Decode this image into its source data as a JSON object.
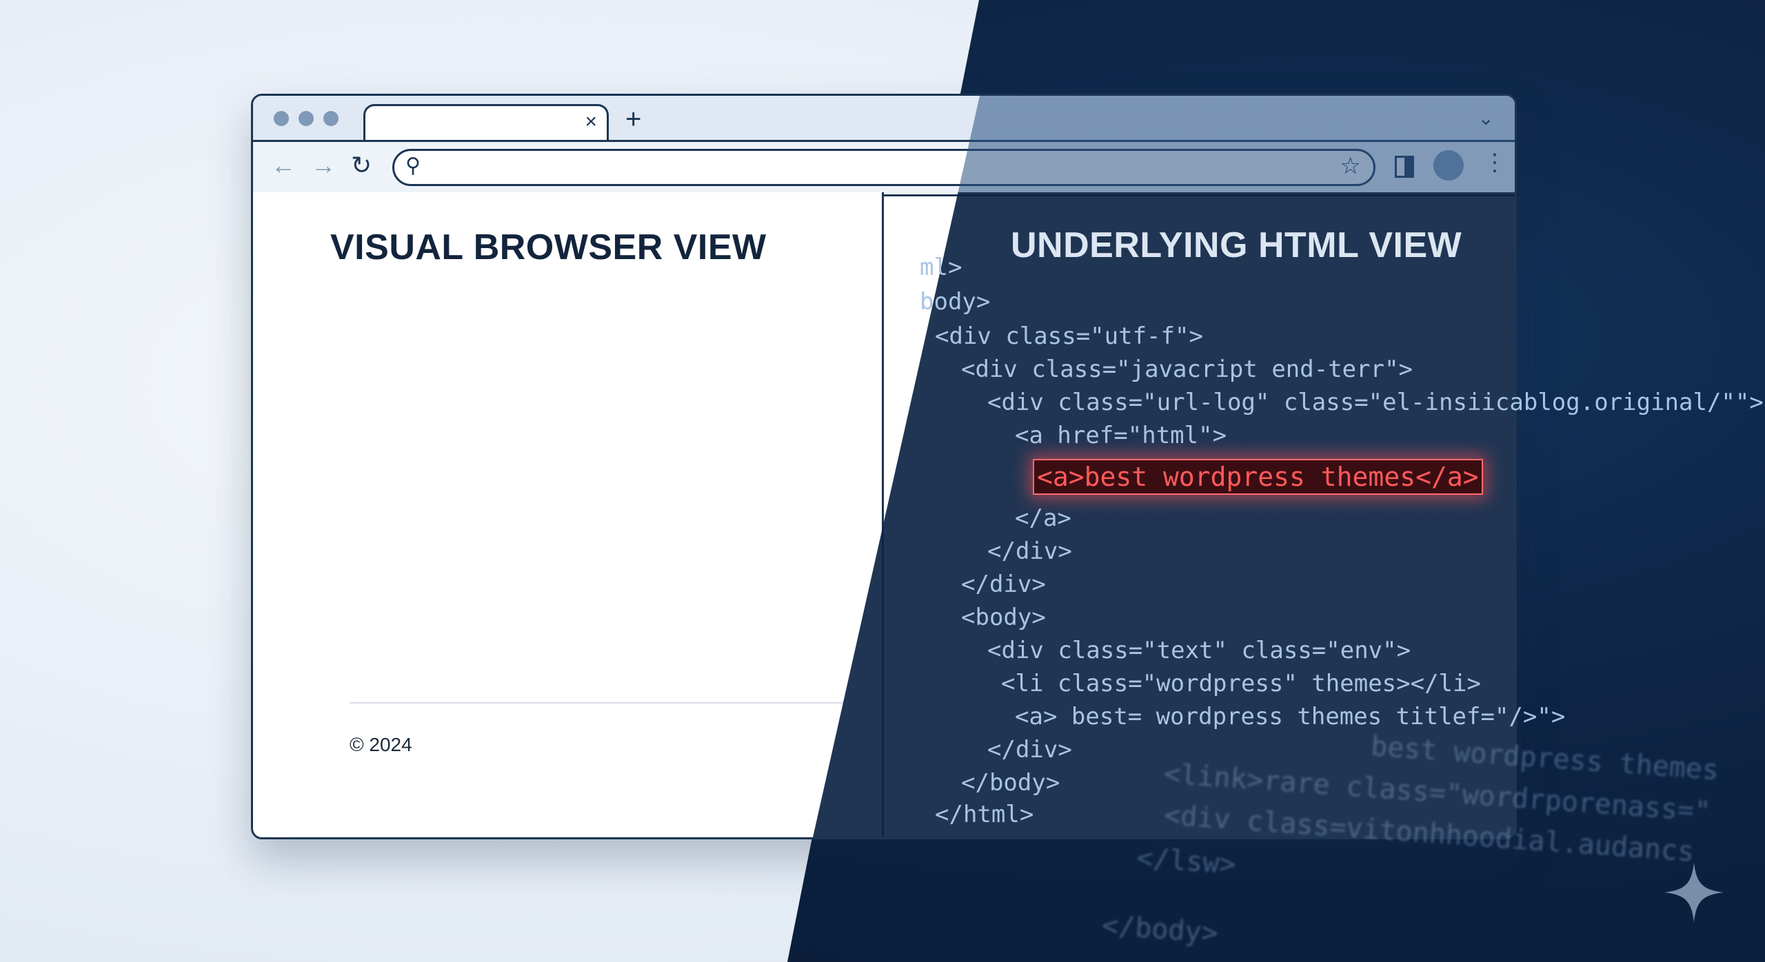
{
  "left_panel": {
    "title": "VISUAL BROWSER VIEW",
    "copyright": "© 2024"
  },
  "right_panel": {
    "title": "UNDERLYING HTML VIEW",
    "code_lines": [
      "ml>",
      "body>",
      "<div class=\"utf-f\">",
      "<div class=\"javacript end-terr\">",
      "<div class=\"url-log\" class=\"el-insiicablog.original/\"\">",
      "<a href=\"html\">",
      "</a>",
      "</div>",
      "</div>",
      "<body>",
      "<div class=\"text\" class=\"env\">",
      "<li class=\"wordpress\" themes></li>",
      "<a> best= wordpress themes titlef=\"/>\">",
      "</div>",
      "</body>",
      "</html>"
    ],
    "highlighted": "<a>best wordpress themes</a>",
    "ghost_lines": [
      "best wordpress themes",
      "<link>rare class=\"wordrporenass=\"",
      "<div class=vitonhhoodial.audancs",
      "</lsw>",
      "</body>"
    ]
  },
  "browser": {
    "tab_close_glyph": "×",
    "new_tab_glyph": "+",
    "icons": {
      "back": "back-arrow-icon",
      "forward": "forward-arrow-icon",
      "reload": "reload-icon",
      "search": "search-icon",
      "bookmark": "star-icon",
      "menu": "kebab-menu-icon"
    }
  },
  "colors": {
    "dark_bg": "#0d2444",
    "highlight": "#ff5a5a",
    "frame": "#1c3554"
  }
}
